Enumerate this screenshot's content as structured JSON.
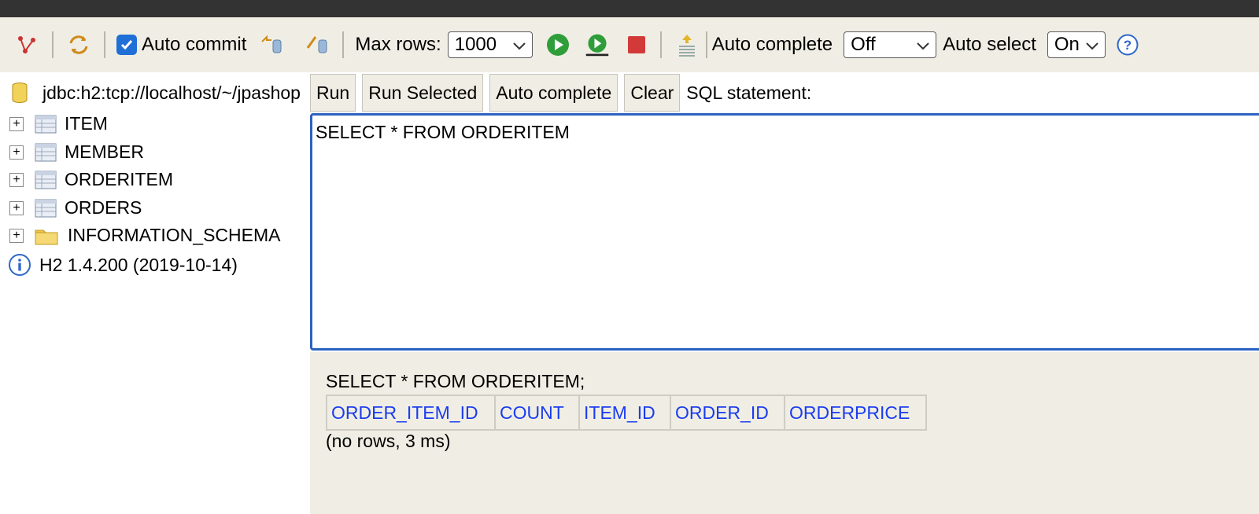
{
  "toolbar": {
    "auto_commit_label": "Auto commit",
    "auto_commit_checked": true,
    "max_rows_label": "Max rows:",
    "max_rows_value": "1000",
    "auto_complete_label": "Auto complete",
    "auto_complete_value": "Off",
    "auto_select_label": "Auto select",
    "auto_select_value": "On",
    "help_glyph": "?"
  },
  "tree": {
    "connection": "jdbc:h2:tcp://localhost/~/jpashop",
    "items": [
      {
        "label": "ITEM",
        "icon": "table-icon"
      },
      {
        "label": "MEMBER",
        "icon": "table-icon"
      },
      {
        "label": "ORDERITEM",
        "icon": "table-icon"
      },
      {
        "label": "ORDERS",
        "icon": "table-icon"
      },
      {
        "label": "INFORMATION_SCHEMA",
        "icon": "folder-icon"
      }
    ],
    "version": "H2 1.4.200 (2019-10-14)"
  },
  "buttons": {
    "run": "Run",
    "run_selected": "Run Selected",
    "auto_complete": "Auto complete",
    "clear": "Clear",
    "sql_label": "SQL statement:"
  },
  "editor": {
    "text": "SELECT * FROM ORDERITEM"
  },
  "result": {
    "query": "SELECT * FROM ORDERITEM;",
    "columns": [
      "ORDER_ITEM_ID",
      "COUNT",
      "ITEM_ID",
      "ORDER_ID",
      "ORDERPRICE"
    ],
    "status": "(no rows, 3 ms)"
  },
  "colors": {
    "accent": "#2b62c0",
    "panel": "#f0eee4",
    "link": "#1a3cf0"
  }
}
